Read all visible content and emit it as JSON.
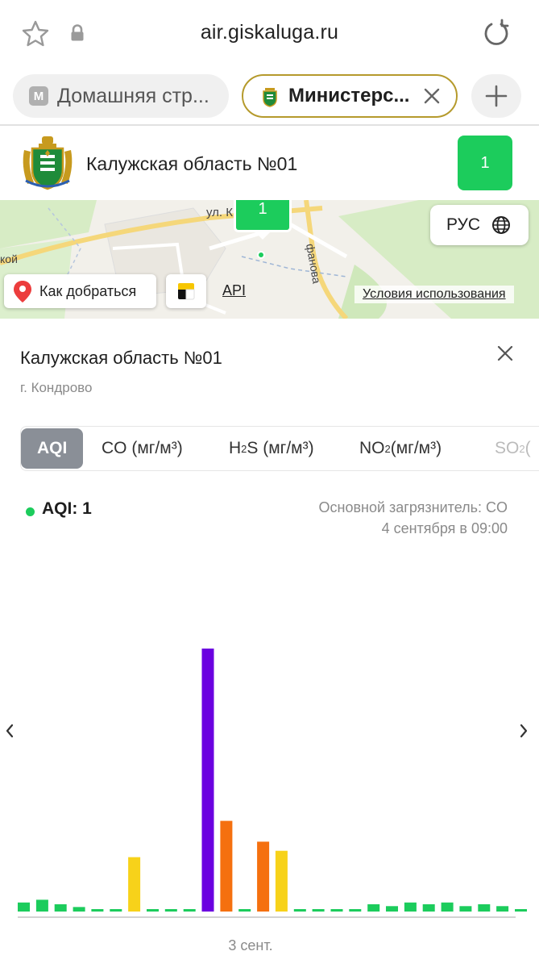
{
  "browser": {
    "url": "air.giskaluga.ru",
    "tabs": [
      {
        "icon_letter": "М",
        "label": "Домашняя стр..."
      },
      {
        "label": "Министерс...",
        "active": true
      }
    ],
    "icons": [
      "star-icon",
      "lock-icon",
      "reload-icon",
      "close-icon",
      "plus-icon"
    ]
  },
  "station": {
    "title": "Калужская область №01",
    "aqi_badge": "1",
    "badge_color": "#1ccc5c"
  },
  "map": {
    "marker_value": "1",
    "street_1": "ул. К",
    "street_2": "фанова",
    "street_3": "кой",
    "lang_button": "РУС",
    "route_button": "Как добраться",
    "api_link": "API",
    "terms_link": "Условия использования"
  },
  "panel": {
    "title": "Калужская область №01",
    "subtitle": "г. Кондрово",
    "tabs": [
      {
        "label": "AQI",
        "active": true
      },
      {
        "label": "CO (мг/м³)"
      },
      {
        "label_main": "H",
        "label_sub": "2",
        "label_rest": "S (мг/м³)"
      },
      {
        "label_main": "NO",
        "label_sub": "2",
        "label_rest": " (мг/м³)"
      },
      {
        "label_main": "SO",
        "label_sub": "2",
        "label_rest": " ("
      }
    ],
    "aqi_text": "AQI: 1",
    "main_pollutant": "Основной загрязнитель: CO",
    "measured_at": "4 сентября в 09:00"
  },
  "chart_data": {
    "type": "bar",
    "xlabel": "3 сент.",
    "ylim": [
      0,
      29
    ],
    "values": [
      1,
      1.3,
      0.8,
      0.5,
      0.2,
      0.2,
      6,
      0.2,
      0.2,
      0.2,
      29,
      10,
      0.2,
      7.7,
      6.7,
      0.2,
      0.2,
      0.2,
      0.2,
      0.8,
      0.6,
      1,
      0.8,
      1,
      0.6,
      0.8,
      0.6,
      0.2
    ],
    "colors": [
      "#1ccc5c",
      "#1ccc5c",
      "#1ccc5c",
      "#1ccc5c",
      "#1ccc5c",
      "#1ccc5c",
      "#f7d21a",
      "#1ccc5c",
      "#1ccc5c",
      "#1ccc5c",
      "#6b00e0",
      "#f5700f",
      "#1ccc5c",
      "#f5700f",
      "#f7d21a",
      "#1ccc5c",
      "#1ccc5c",
      "#1ccc5c",
      "#1ccc5c",
      "#1ccc5c",
      "#1ccc5c",
      "#1ccc5c",
      "#1ccc5c",
      "#1ccc5c",
      "#1ccc5c",
      "#1ccc5c",
      "#1ccc5c",
      "#1ccc5c"
    ]
  }
}
